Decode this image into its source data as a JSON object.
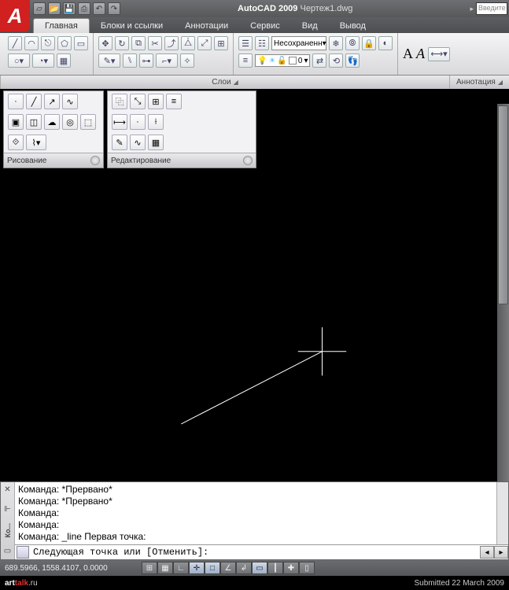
{
  "app": {
    "name": "AutoCAD 2009",
    "document": "Чертеж1.dwg",
    "search_placeholder": "Введите"
  },
  "tabs": {
    "t0": "Главная",
    "t1": "Блоки и ссылки",
    "t2": "Аннотации",
    "t3": "Сервис",
    "t4": "Вид",
    "t5": "Вывод"
  },
  "panels": {
    "layers_title": "Слои",
    "annotation_title": "Аннотация",
    "draw_title": "Рисование",
    "edit_title": "Редактирование",
    "layer_selected": "Несохраненн",
    "layer_current": "0"
  },
  "annotation": {
    "A1": "A",
    "A2": "A"
  },
  "command": {
    "gutter_close": "✕",
    "gutter_pin": "⊩",
    "gutter_label": "Ко...",
    "line1": "Команда: *Прервано*",
    "line2": "Команда: *Прервано*",
    "line3": "Команда:",
    "line4": "Команда:",
    "line5": "Команда: _line Первая точка:",
    "prompt": "Следующая точка или [Отменить]:"
  },
  "status": {
    "coords": "689.5966, 1558.4107, 0.0000"
  },
  "footer": {
    "site_prefix": "art",
    "site_mid": "talk",
    "site_suffix": ".ru",
    "submitted": "Submitted 22 March 2009"
  }
}
